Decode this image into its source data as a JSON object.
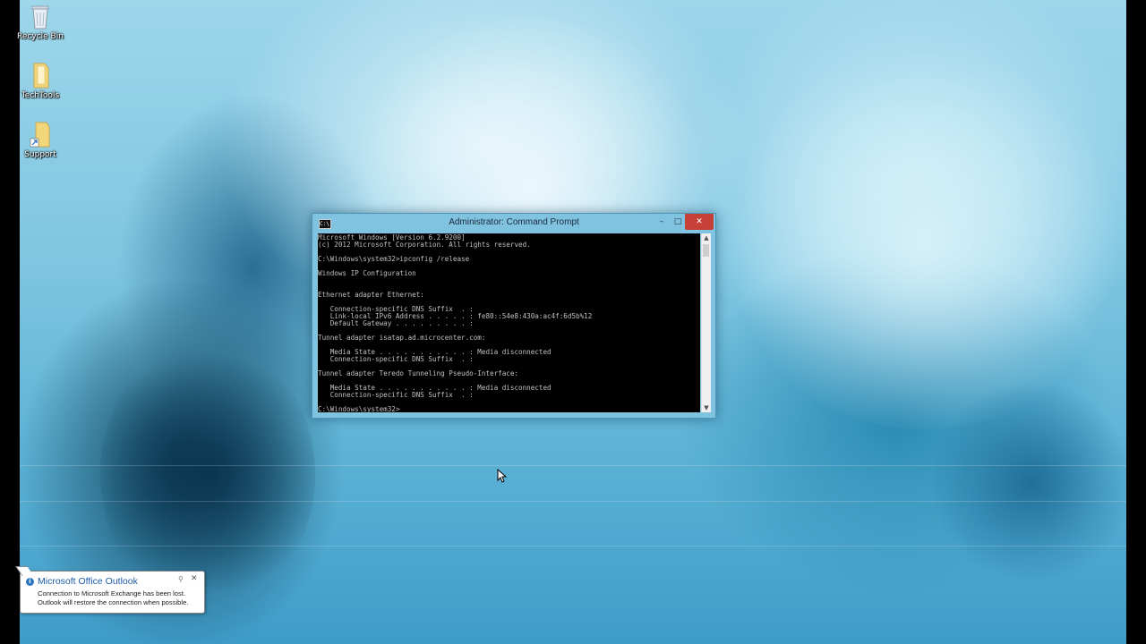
{
  "desktop": {
    "icons": [
      {
        "label": "Recycle Bin",
        "icon": "recycle-bin-icon"
      },
      {
        "label": "TechTools",
        "icon": "folder-icon"
      },
      {
        "label": "Support",
        "icon": "folder-shortcut-icon"
      }
    ]
  },
  "cmd_window": {
    "title": "Administrator: Command Prompt",
    "icon": "cmd-icon",
    "buttons": {
      "minimize": "–",
      "maximize": "□",
      "close": "✕"
    },
    "output": "Microsoft Windows [Version 6.2.9200]\n(c) 2012 Microsoft Corporation. All rights reserved.\n\nC:\\Windows\\system32>ipconfig /release\n\nWindows IP Configuration\n\n\nEthernet adapter Ethernet:\n\n   Connection-specific DNS Suffix  . :\n   Link-local IPv6 Address . . . . . : fe80::54e8:430a:ac4f:6d5b%12\n   Default Gateway . . . . . . . . . :\n\nTunnel adapter isatap.ad.microcenter.com:\n\n   Media State . . . . . . . . . . . : Media disconnected\n   Connection-specific DNS Suffix  . :\n\nTunnel adapter Teredo Tunneling Pseudo-Interface:\n\n   Media State . . . . . . . . . . . : Media disconnected\n   Connection-specific DNS Suffix  . :\n\nC:\\Windows\\system32>"
  },
  "notification": {
    "title": "Microsoft Office Outlook",
    "line1": "Connection to Microsoft Exchange has been lost.",
    "line2": "Outlook will restore the connection when possible.",
    "icon": "info-icon"
  },
  "colors": {
    "close_button": "#c74037",
    "console_bg": "#000000",
    "console_text": "#c0c0c0",
    "window_frame": "#7fc3e0",
    "notify_title": "#1e5aa8"
  }
}
